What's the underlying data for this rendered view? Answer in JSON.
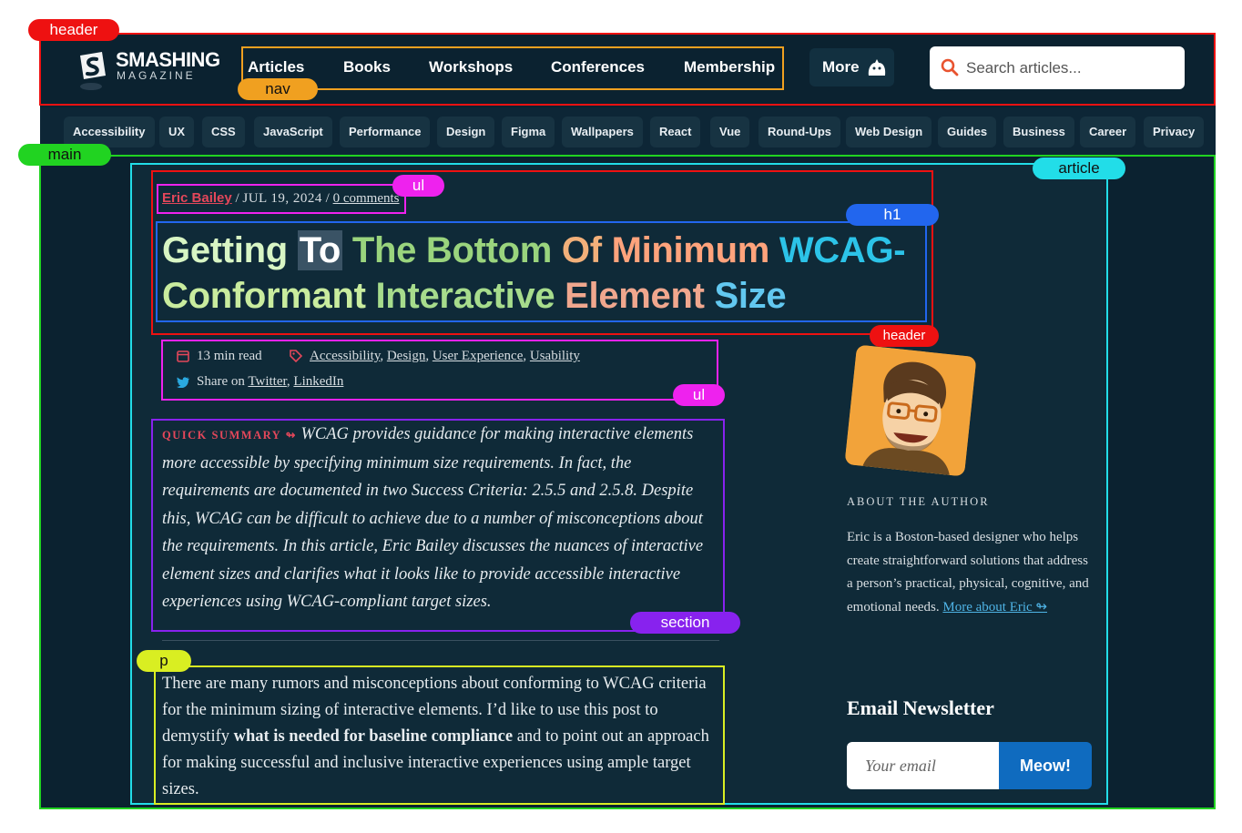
{
  "colors": {
    "page_bg": "#0b2230",
    "accent_red": "#e3475a",
    "link_blue": "#4fb4e6",
    "button_blue": "#0f6bbf"
  },
  "annotations": {
    "header": "header",
    "nav": "nav",
    "main": "main",
    "article": "article",
    "ul_top": "ul",
    "h1": "h1",
    "article_header": "header",
    "ul_info": "ul",
    "section": "section",
    "p": "p"
  },
  "header": {
    "logo": {
      "line1": "SMASHING",
      "line2": "MAGAZINE"
    },
    "nav": [
      "Articles",
      "Books",
      "Workshops",
      "Conferences",
      "Membership"
    ],
    "more_label": "More",
    "search_placeholder": "Search articles..."
  },
  "categories": [
    "Accessibility",
    "UX",
    "CSS",
    "JavaScript",
    "Performance",
    "Design",
    "Figma",
    "Wallpapers",
    "React",
    "Vue",
    "Round-Ups",
    "Web Design",
    "Guides",
    "Business",
    "Career",
    "Privacy"
  ],
  "article": {
    "author": "Eric Bailey",
    "sep1": " / ",
    "date": "JUL 19, 2024",
    "sep2": " / ",
    "comments": "0 comments",
    "title_words": [
      "Getting",
      "To",
      "The Bottom",
      "Of",
      "Minimum",
      "WCAG-",
      "Conformant",
      "Interactive",
      "Element",
      "Size"
    ],
    "read_time": "13 min read",
    "tags": [
      "Accessibility",
      "Design",
      "User Experience",
      "Usability"
    ],
    "share_label": "Share on",
    "share_links": [
      "Twitter",
      "LinkedIn"
    ],
    "summary_label": "QUICK SUMMARY",
    "summary_arrow": "↬",
    "summary_text": "WCAG provides guidance for making interactive elements more accessible by specifying minimum size requirements. In fact, the requirements are documented in two Success Criteria: 2.5.5 and 2.5.8. Despite this, WCAG can be difficult to achieve due to a number of misconceptions about the requirements. In this article, Eric Bailey discusses the nuances of interactive element sizes and clarifies what it looks like to provide accessible interactive experiences using WCAG-compliant target sizes.",
    "body_pre": "There are many rumors and misconceptions about conforming to WCAG criteria for the minimum sizing of interactive elements. I’d like to use this post to demystify ",
    "body_bold": "what is needed for baseline compliance",
    "body_post": " and to point out an approach for making successful and inclusive interactive experiences using ample target sizes."
  },
  "sidebar": {
    "about_heading": "ABOUT THE AUTHOR",
    "about_text": "Eric is a Boston-based designer who helps create straightforward solutions that address a person’s practical, physical, cognitive, and emotional needs. ",
    "more_link": "More about Eric ↬",
    "newsletter_heading": "Email Newsletter",
    "email_placeholder": "Your email",
    "subscribe_label": "Meow!"
  }
}
